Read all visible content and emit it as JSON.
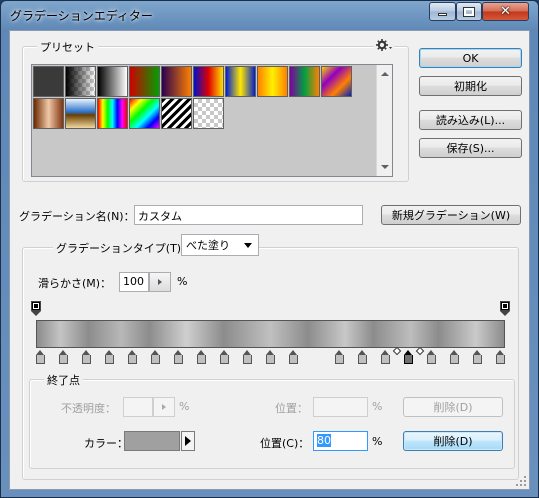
{
  "window": {
    "title": "グラデーションエディター",
    "close_glyph": "✕",
    "colors": {
      "titlebar": "#6a93c0",
      "client_bg": "#f0f0f0"
    }
  },
  "presets": {
    "label": "プリセット",
    "menu_icon": "gear-icon",
    "swatches": [
      {
        "name": "dark-gray",
        "css": "#3a3a3a"
      },
      {
        "name": "black-to-transparent",
        "css": "linear-gradient(90deg,#000,rgba(0,0,0,0))",
        "checker": true
      },
      {
        "name": "black-to-white",
        "css": "linear-gradient(90deg,#000,#fff)"
      },
      {
        "name": "red-to-green",
        "css": "linear-gradient(90deg,#d00000,#00a000)"
      },
      {
        "name": "violet-to-orange",
        "css": "linear-gradient(90deg,#2a0050,#ff8000)"
      },
      {
        "name": "blue-red-yellow",
        "css": "linear-gradient(90deg,#0010c8,#e00000,#ffe000)"
      },
      {
        "name": "blue-yellow-blue",
        "css": "linear-gradient(90deg,#0020d0,#ffe800,#0020d0)"
      },
      {
        "name": "orange-yellow-orange",
        "css": "linear-gradient(90deg,#ff8000,#fff000,#ff8000)"
      },
      {
        "name": "violet-green-orange",
        "css": "linear-gradient(90deg,#8000a0,#00a040,#ff8000)"
      },
      {
        "name": "yellow-violet-orange-blue",
        "css": "linear-gradient(135deg,#ffd000,#9000c0,#ff8000,#0020c0)"
      },
      {
        "name": "copper",
        "css": "linear-gradient(90deg,#6a2800,#f0c8a8,#803410)"
      },
      {
        "name": "chrome",
        "css": "linear-gradient(180deg,#e8f4ff 0%,#2a70c8 45%,#6a4000 55%,#f0d8a0 100%)"
      },
      {
        "name": "spectrum",
        "css": "linear-gradient(90deg,#f00,#ff0,#0f0,#0ff,#00f,#f0f,#f00)"
      },
      {
        "name": "transparent-rainbow",
        "css": "linear-gradient(135deg,#f00,#ff0,#0f0,#0ff,#00f,#f0f)"
      },
      {
        "name": "transparent-stripes",
        "css": "repeating-linear-gradient(135deg,#000 0 3px,#fff 3px 6px)"
      },
      {
        "name": "transparent-checker",
        "css": "transparent",
        "checker": true
      }
    ]
  },
  "buttons": {
    "ok": "OK",
    "reset": "初期化",
    "load": "読み込み(L)...",
    "save": "保存(S)...",
    "new_gradient": "新規グラデーション(W)"
  },
  "name_field": {
    "label": "グラデーション名(N)：",
    "value": "カスタム"
  },
  "gradient_type": {
    "label": "グラデーションタイプ(T)：",
    "value": "べた塗り"
  },
  "smoothness": {
    "label": "滑らかさ(M)：",
    "value": "100",
    "unit": "%"
  },
  "gradient_bar": {
    "css": "linear-gradient(90deg,#8c8c8c 0%,#c4c4c4 5%,#8c8c8c 11%,#b8b8b8 18%,#8c8c8c 24%,#cfcfcf 32%,#8c8c8c 40%,#c0c0c0 50%,#8c8c8c 58%,#c8c8c8 66%,#8c8c8c 72%,#bdbdbd 80%,#8c8c8c 86%,#cacaca 94%,#8c8c8c 100%)",
    "opacity_stop_color": "#000000",
    "color_stops": [
      0,
      5,
      10,
      15,
      20,
      25,
      30,
      35,
      40,
      45,
      50,
      55,
      65,
      70,
      75,
      80,
      85,
      90,
      95,
      100
    ],
    "selected_stop": 80,
    "stop_fill": "#c0c0c0",
    "selected_fill": "#707070"
  },
  "stops": {
    "group_label": "終了点",
    "opacity_label": "不透明度：",
    "opacity_unit": "%",
    "opacity_location_label": "位置：",
    "opacity_location_unit": "%",
    "opacity_delete": "削除(D)",
    "color_label": "カラー：",
    "color_value": "#a0a0a0",
    "color_location_label": "位置(C)：",
    "color_location_value": "80",
    "color_location_unit": "%",
    "color_delete": "削除(D)"
  }
}
